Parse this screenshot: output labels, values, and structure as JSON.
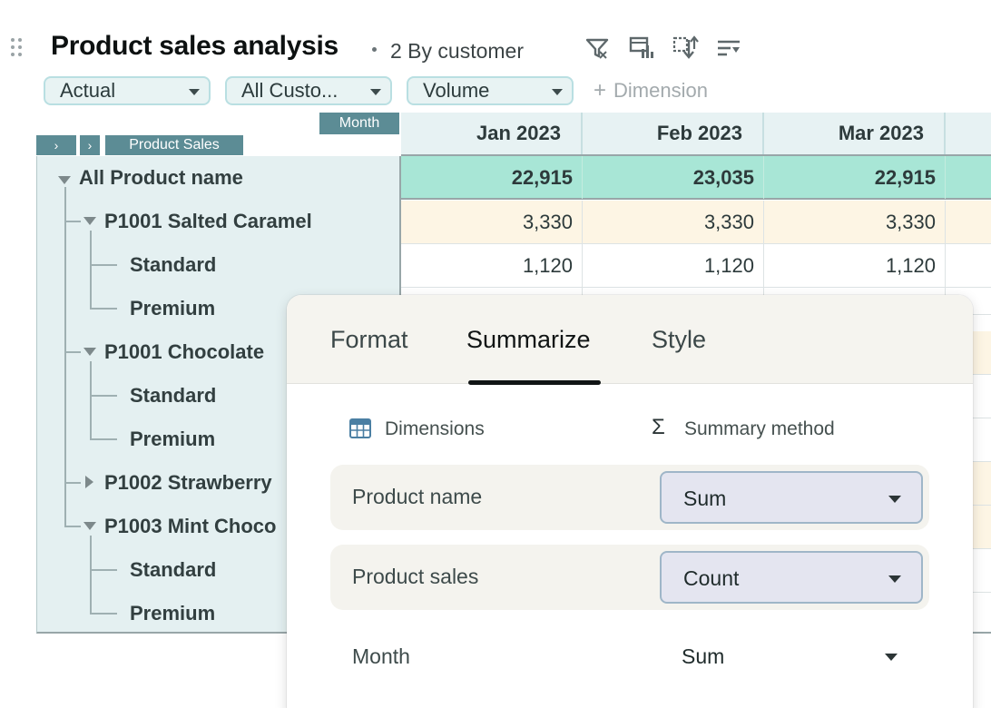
{
  "header": {
    "title": "Product sales analysis",
    "subtitle": "2 By customer",
    "toolbar_icons": [
      "filter-icon",
      "chart-settings-icon",
      "swap-icon",
      "sort-icon"
    ]
  },
  "filters": [
    {
      "label": "Actual"
    },
    {
      "label": "All Custo..."
    },
    {
      "label": "Volume"
    }
  ],
  "add_dimension_label": "Dimension",
  "pivot": {
    "column_axis_label": "Month",
    "row_axis_label": "Product Sales",
    "expand_glyph": "›",
    "columns": [
      "Jan 2023",
      "Feb 2023",
      "Mar 2023"
    ],
    "rows": [
      {
        "label": "All Product name",
        "values": [
          "22,915",
          "23,035",
          "22,915"
        ]
      },
      {
        "label": "P1001 Salted Caramel",
        "values": [
          "3,330",
          "3,330",
          "3,330"
        ]
      },
      {
        "label": "Standard",
        "values": [
          "1,120",
          "1,120",
          "1,120"
        ]
      },
      {
        "label": "Premium"
      },
      {
        "label": "P1001 Chocolate"
      },
      {
        "label": "Standard"
      },
      {
        "label": "Premium"
      },
      {
        "label": "P1002 Strawberry"
      },
      {
        "label": "P1003 Mint Choco"
      },
      {
        "label": "Standard"
      },
      {
        "label": "Premium"
      }
    ]
  },
  "popover": {
    "tabs": [
      "Format",
      "Summarize",
      "Style"
    ],
    "active_tab": "Summarize",
    "dimensions_header": "Dimensions",
    "summary_header": "Summary method",
    "sigma_glyph": "Σ",
    "methods": [
      {
        "name": "Product name",
        "method": "Sum"
      },
      {
        "name": "Product sales",
        "method": "Count"
      },
      {
        "name": "Month",
        "method": "Sum"
      }
    ]
  },
  "colors": {
    "accent_teal": "#5c8c95",
    "total_row": "#a8e6d6",
    "subtotal_row": "#fdf5e4",
    "header_bg": "#e7f2f3"
  }
}
